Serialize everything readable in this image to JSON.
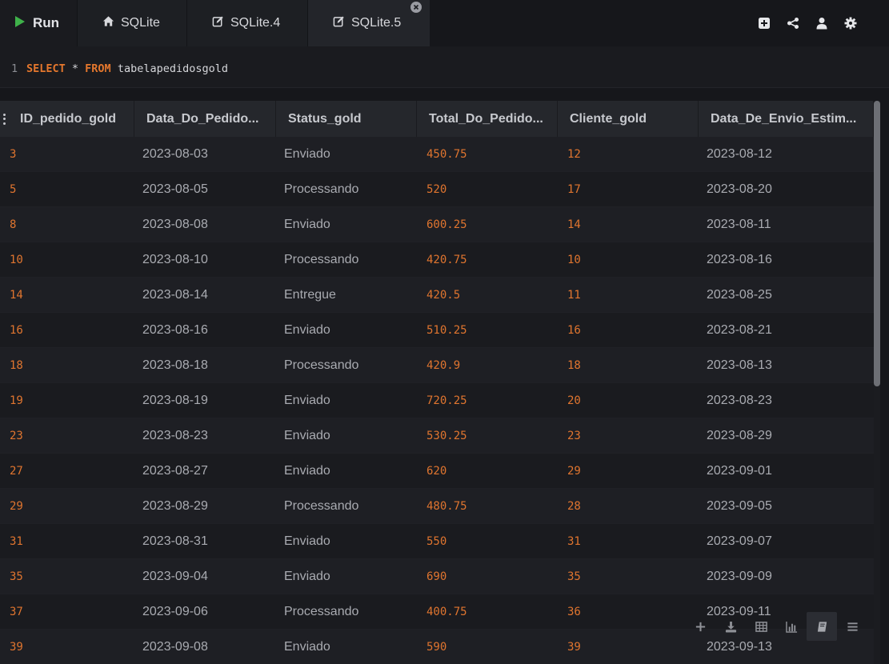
{
  "toolbar": {
    "run_label": "Run",
    "tabs": [
      {
        "label": "SQLite",
        "icon": "home-icon"
      },
      {
        "label": "SQLite.4",
        "icon": "edit-icon"
      },
      {
        "label": "SQLite.5",
        "icon": "edit-icon",
        "active": true
      }
    ],
    "right_icons": [
      "add-icon",
      "share-icon",
      "user-icon",
      "gear-icon"
    ]
  },
  "editor": {
    "line_number": "1",
    "kw_select": "SELECT",
    "star": " * ",
    "kw_from": "FROM",
    "table": " tabelapedidosgold"
  },
  "grid": {
    "columns": [
      "ID_pedido_gold",
      "Data_Do_Pedido...",
      "Status_gold",
      "Total_Do_Pedido...",
      "Cliente_gold",
      "Data_De_Envio_Estim..."
    ],
    "rows": [
      [
        "3",
        "2023-08-03",
        "Enviado",
        "450.75",
        "12",
        "2023-08-12"
      ],
      [
        "5",
        "2023-08-05",
        "Processando",
        "520",
        "17",
        "2023-08-20"
      ],
      [
        "8",
        "2023-08-08",
        "Enviado",
        "600.25",
        "14",
        "2023-08-11"
      ],
      [
        "10",
        "2023-08-10",
        "Processando",
        "420.75",
        "10",
        "2023-08-16"
      ],
      [
        "14",
        "2023-08-14",
        "Entregue",
        "420.5",
        "11",
        "2023-08-25"
      ],
      [
        "16",
        "2023-08-16",
        "Enviado",
        "510.25",
        "16",
        "2023-08-21"
      ],
      [
        "18",
        "2023-08-18",
        "Processando",
        "420.9",
        "18",
        "2023-08-13"
      ],
      [
        "19",
        "2023-08-19",
        "Enviado",
        "720.25",
        "20",
        "2023-08-23"
      ],
      [
        "23",
        "2023-08-23",
        "Enviado",
        "530.25",
        "23",
        "2023-08-29"
      ],
      [
        "27",
        "2023-08-27",
        "Enviado",
        "620",
        "29",
        "2023-09-01"
      ],
      [
        "29",
        "2023-08-29",
        "Processando",
        "480.75",
        "28",
        "2023-09-05"
      ],
      [
        "31",
        "2023-08-31",
        "Enviado",
        "550",
        "31",
        "2023-09-07"
      ],
      [
        "35",
        "2023-09-04",
        "Enviado",
        "690",
        "35",
        "2023-09-09"
      ],
      [
        "37",
        "2023-09-06",
        "Processando",
        "400.75",
        "36",
        "2023-09-11"
      ],
      [
        "39",
        "2023-09-08",
        "Enviado",
        "590",
        "39",
        "2023-09-13"
      ]
    ]
  },
  "grid_tools": [
    "plus-icon",
    "download-icon",
    "table-icon",
    "bar-chart-icon",
    "book-icon",
    "menu-icon"
  ],
  "colors": {
    "accent_orange": "#e0752f",
    "run_green": "#3fb24a",
    "background": "#16171b"
  }
}
